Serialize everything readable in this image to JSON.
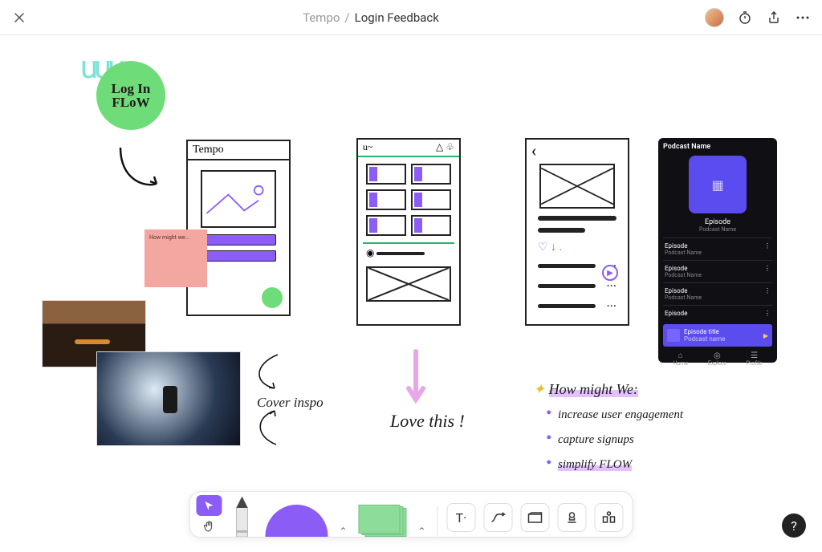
{
  "header": {
    "breadcrumb_parent": "Tempo",
    "breadcrumb_sep": "/",
    "breadcrumb_current": "Login Feedback"
  },
  "canvas": {
    "login_badge": "Log In\nFLoW",
    "sticky_text": "How might we...",
    "sketch1_title": "Tempo",
    "cover_inspo": "Cover inspo",
    "love_this": "Love this !",
    "hmw": {
      "title": "How might We:",
      "items": [
        "increase user engagement",
        "capture signups",
        "simplify FLOW"
      ]
    },
    "dark": {
      "header": "Podcast Name",
      "episode": "Episode",
      "subtitle": "Podcast Name",
      "rows": [
        {
          "l1": "Episode",
          "l2": "Podcast Name"
        },
        {
          "l1": "Episode",
          "l2": "Podcast Name"
        },
        {
          "l1": "Episode",
          "l2": "Podcast Name"
        },
        {
          "l1": "Episode",
          "l2": ""
        }
      ],
      "now_l1": "Episode title",
      "now_l2": "Podcast name",
      "tabs": [
        "Home",
        "Explore",
        "Profile"
      ]
    }
  },
  "toolbar": {
    "help": "?"
  }
}
